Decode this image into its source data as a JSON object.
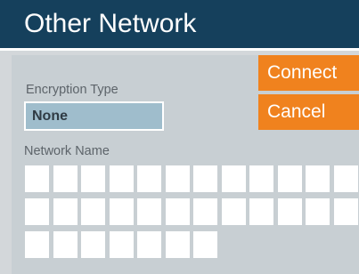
{
  "header": {
    "title": "Other Network"
  },
  "buttons": {
    "connect": "Connect",
    "cancel": "Cancel"
  },
  "encryption": {
    "label": "Encryption Type",
    "value": "None"
  },
  "network_name": {
    "label": "Network Name",
    "value": ""
  },
  "colors": {
    "title_bar": "#15405c",
    "accent": "#f0821e",
    "select_bg": "#9fbdcc",
    "panel_bg": "#c8cfd3"
  }
}
